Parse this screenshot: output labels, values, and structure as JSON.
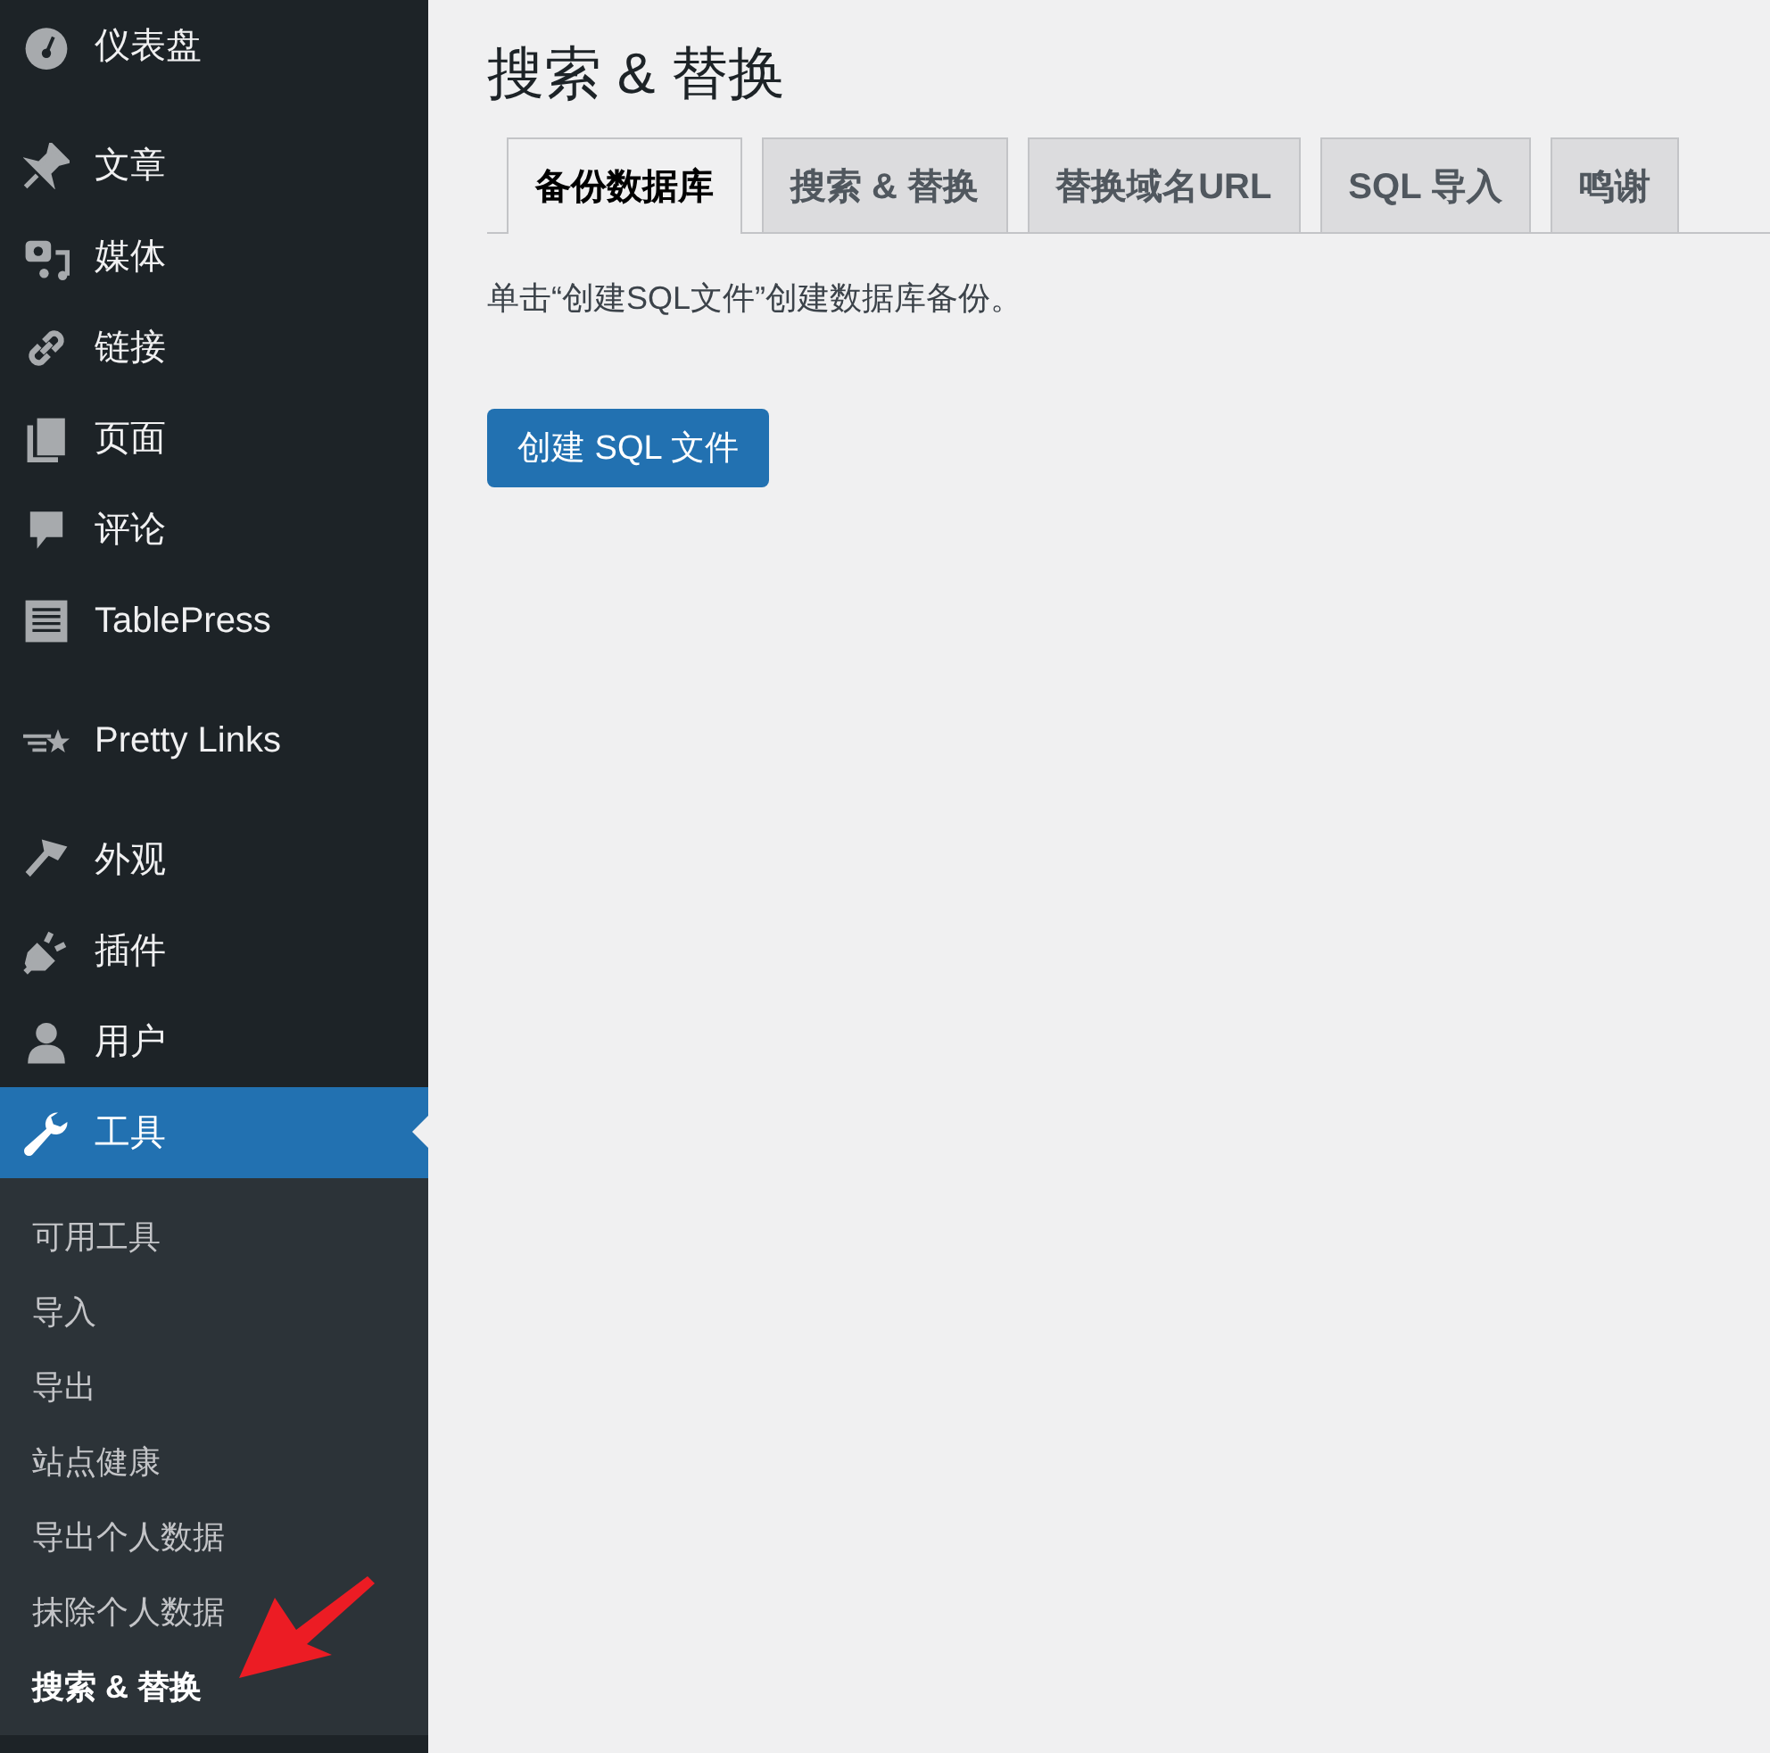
{
  "sidebar": {
    "groups": [
      {
        "items": [
          {
            "label": "仪表盘",
            "selected": false
          }
        ]
      },
      {
        "items": [
          {
            "label": "文章",
            "selected": false
          },
          {
            "label": "媒体",
            "selected": false
          },
          {
            "label": "链接",
            "selected": false
          },
          {
            "label": "页面",
            "selected": false
          },
          {
            "label": "评论",
            "selected": false
          },
          {
            "label": "TablePress",
            "selected": false
          }
        ]
      },
      {
        "items": [
          {
            "label": "Pretty Links",
            "selected": false
          }
        ]
      },
      {
        "items": [
          {
            "label": "外观",
            "selected": false
          },
          {
            "label": "插件",
            "selected": false
          },
          {
            "label": "用户",
            "selected": false
          },
          {
            "label": "工具",
            "selected": true,
            "children": [
              {
                "label": "可用工具",
                "selected": false
              },
              {
                "label": "导入",
                "selected": false
              },
              {
                "label": "导出",
                "selected": false
              },
              {
                "label": "站点健康",
                "selected": false
              },
              {
                "label": "导出个人数据",
                "selected": false
              },
              {
                "label": "抹除个人数据",
                "selected": false
              },
              {
                "label": "搜索 & 替换",
                "selected": true
              }
            ]
          }
        ]
      }
    ]
  },
  "main": {
    "title": "搜索 & 替换",
    "tabs": [
      {
        "label": "备份数据库",
        "selected": true
      },
      {
        "label": "搜索 & 替换",
        "selected": false
      },
      {
        "label": "替换域名URL",
        "selected": false
      },
      {
        "label": "SQL 导入",
        "selected": false
      },
      {
        "label": "鸣谢",
        "selected": false
      }
    ],
    "description": "单击“创建SQL文件”创建数据库备份。",
    "button": "创建 SQL 文件"
  }
}
